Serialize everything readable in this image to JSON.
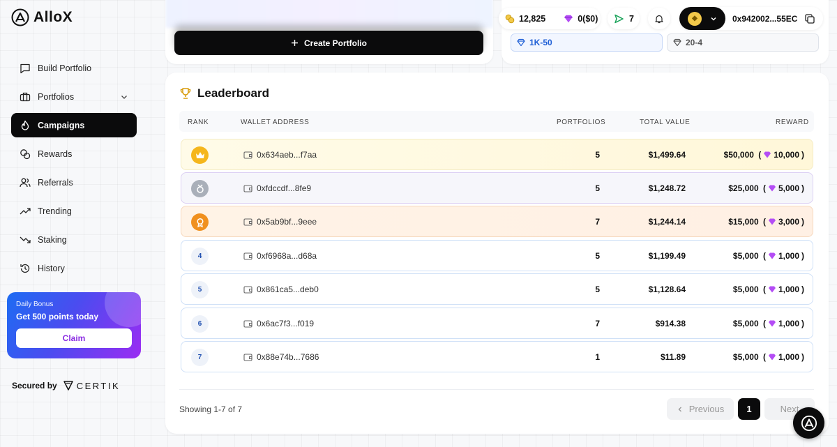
{
  "app": {
    "brand": "AlloX"
  },
  "sidebar": {
    "items": [
      {
        "label": "Build Portfolio",
        "icon": "chat-square-icon"
      },
      {
        "label": "Portfolios",
        "icon": "briefcase-icon"
      },
      {
        "label": "Campaigns",
        "icon": "flame-icon",
        "active": true
      },
      {
        "label": "Rewards",
        "icon": "coins-icon"
      },
      {
        "label": "Referrals",
        "icon": "users-icon"
      },
      {
        "label": "Trending",
        "icon": "trending-up-icon"
      },
      {
        "label": "Staking",
        "icon": "trending-down-icon"
      },
      {
        "label": "History",
        "icon": "history-icon"
      }
    ],
    "bonus": {
      "small": "Daily Bonus",
      "title": "Get 500 points today",
      "button": "Claim"
    },
    "secured_by": "Secured by",
    "certik": "CERTIK"
  },
  "top": {
    "create_portfolio": "Create Portfolio",
    "tags": [
      "1K-50",
      "20-4"
    ]
  },
  "header": {
    "points": "12,825",
    "gems": "0($0)",
    "sends": "7",
    "wallet": "0x942002...55EC"
  },
  "leaderboard": {
    "title": "Leaderboard",
    "columns": {
      "rank": "RANK",
      "wallet": "WALLET ADDRESS",
      "portfolios": "PORTFOLIOS",
      "total_value": "TOTAL VALUE",
      "reward": "REWARD"
    },
    "rows": [
      {
        "rank": "1",
        "wallet": "0x634aeb...f7aa",
        "portfolios": "5",
        "total_value": "$1,499.64",
        "reward_usd": "$50,000",
        "reward_gems": "10,000"
      },
      {
        "rank": "2",
        "wallet": "0xfdccdf...8fe9",
        "portfolios": "5",
        "total_value": "$1,248.72",
        "reward_usd": "$25,000",
        "reward_gems": "5,000"
      },
      {
        "rank": "3",
        "wallet": "0x5ab9bf...9eee",
        "portfolios": "7",
        "total_value": "$1,244.14",
        "reward_usd": "$15,000",
        "reward_gems": "3,000"
      },
      {
        "rank": "4",
        "wallet": "0xf6968a...d68a",
        "portfolios": "5",
        "total_value": "$1,199.49",
        "reward_usd": "$5,000",
        "reward_gems": "1,000"
      },
      {
        "rank": "5",
        "wallet": "0x861ca5...deb0",
        "portfolios": "5",
        "total_value": "$1,128.64",
        "reward_usd": "$5,000",
        "reward_gems": "1,000"
      },
      {
        "rank": "6",
        "wallet": "0x6ac7f3...f019",
        "portfolios": "7",
        "total_value": "$914.38",
        "reward_usd": "$5,000",
        "reward_gems": "1,000"
      },
      {
        "rank": "7",
        "wallet": "0x88e74b...7686",
        "portfolios": "1",
        "total_value": "$11.89",
        "reward_usd": "$5,000",
        "reward_gems": "1,000"
      }
    ],
    "showing": "Showing 1-7 of 7",
    "pagination": {
      "previous": "Previous",
      "page": "1",
      "next": "Next"
    }
  },
  "colors": {
    "accent_dark": "#0b0b0c",
    "gem_purple": "#9b2cf2",
    "link_blue": "#1f5fd6",
    "gold": "#f5b61c",
    "bronze": "#f0901e",
    "silver": "#a9afb9"
  }
}
